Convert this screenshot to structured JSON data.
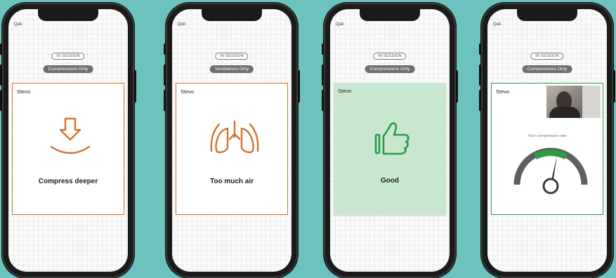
{
  "colors": {
    "background": "#6cc3bd",
    "warning": "#d3732c",
    "good": "#2e9a47",
    "good_fill": "#c9e7cf",
    "gauge_gray": "#5f5f5f"
  },
  "phones": [
    {
      "quit_label": "Quit",
      "status": "IN SESSION",
      "mode": "Compressions Only",
      "card": {
        "name": "Stevo",
        "icon": "compress-arrow-icon",
        "message": "Compress deeper"
      }
    },
    {
      "quit_label": "Quit",
      "status": "IN SESSION",
      "mode": "Ventilations Only",
      "card": {
        "name": "Stevo",
        "icon": "lungs-icon",
        "message": "Too much air"
      }
    },
    {
      "quit_label": "Quit",
      "status": "IN SESSION",
      "mode": "Compressions Only",
      "card": {
        "name": "Stevo",
        "icon": "thumbs-up-icon",
        "message": "Good"
      }
    },
    {
      "quit_label": "Quit",
      "status": "IN SESSION",
      "mode": "Compressions Only",
      "card": {
        "name": "Stevo",
        "icon": "gauge-icon",
        "gauge_label": "Your compression rate",
        "video": "video-feed-thumbnail"
      }
    }
  ]
}
